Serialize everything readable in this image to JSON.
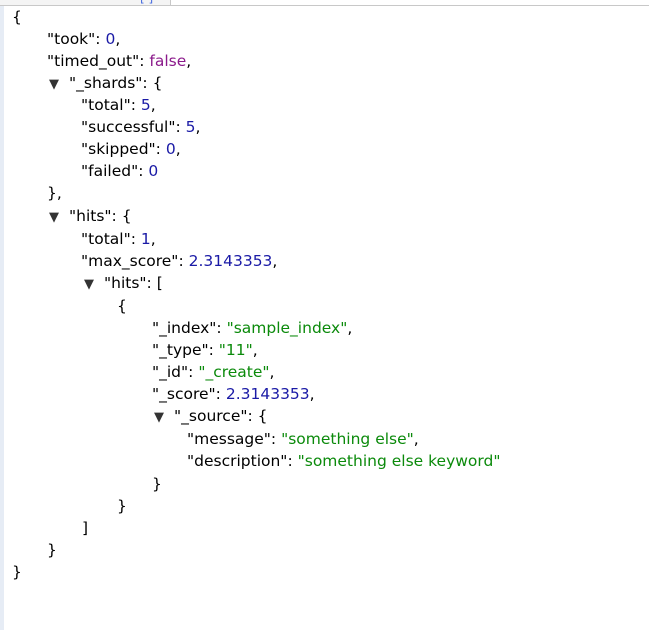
{
  "colors": {
    "number": "#1a1aa6",
    "string": "#0b8a0b",
    "boolean": "#8b1a8b",
    "key": "#000000"
  },
  "icons": {
    "toggle": "collapse-triangle-icon"
  },
  "toggle_glyph": "▼",
  "json": {
    "open_brace": "{",
    "took_key": "\"took\"",
    "took_value": "0",
    "timed_out_key": "\"timed_out\"",
    "timed_out_value": "false",
    "shards_key": "\"_shards\"",
    "shards_total_key": "\"total\"",
    "shards_total_value": "5",
    "shards_successful_key": "\"successful\"",
    "shards_successful_value": "5",
    "shards_skipped_key": "\"skipped\"",
    "shards_skipped_value": "0",
    "shards_failed_key": "\"failed\"",
    "shards_failed_value": "0",
    "hits_key": "\"hits\"",
    "hits_total_key": "\"total\"",
    "hits_total_value": "1",
    "hits_max_score_key": "\"max_score\"",
    "hits_max_score_value": "2.3143353",
    "hits_hits_key": "\"hits\"",
    "index_key": "\"_index\"",
    "index_value": "\"sample_index\"",
    "type_key": "\"_type\"",
    "type_value": "\"11\"",
    "id_key": "\"_id\"",
    "id_value": "\"_create\"",
    "score_key": "\"_score\"",
    "score_value": "2.3143353",
    "source_key": "\"_source\"",
    "message_key": "\"message\"",
    "message_value": "\"something else\"",
    "description_key": "\"description\"",
    "description_value": "\"something else keyword\""
  }
}
